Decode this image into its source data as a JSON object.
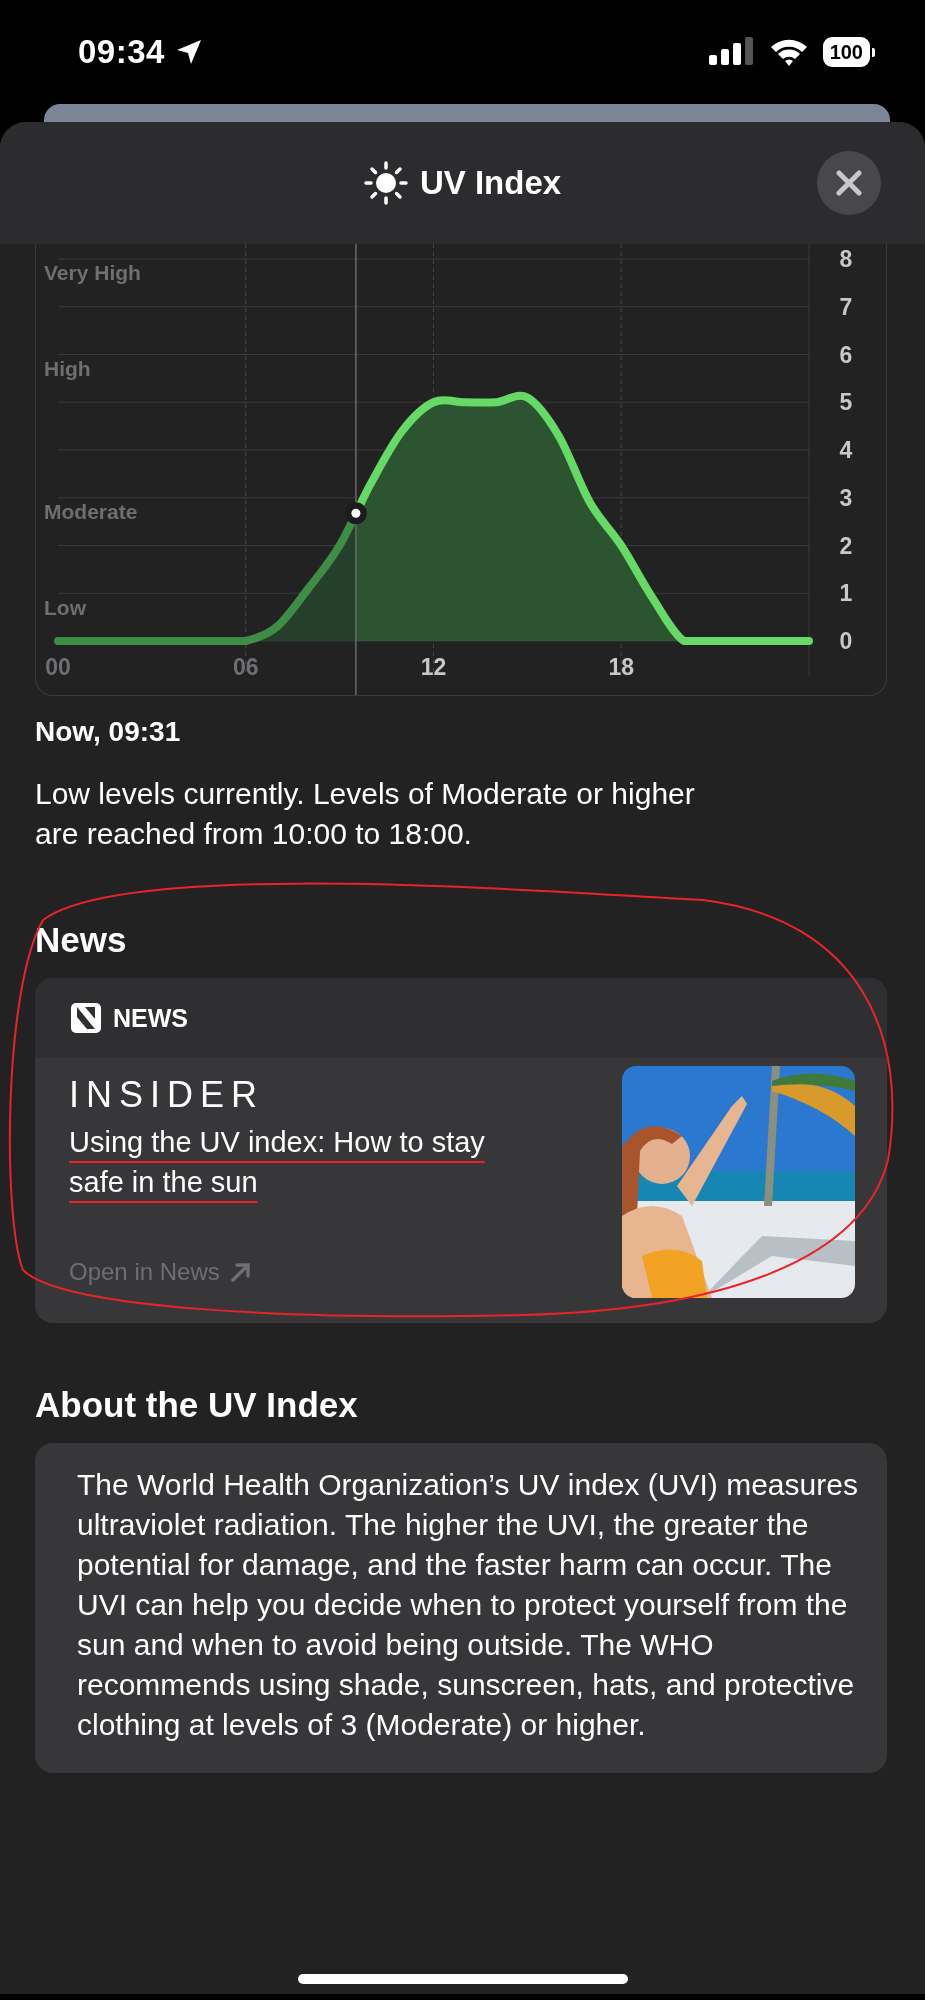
{
  "status_bar": {
    "time": "09:34",
    "battery": "100"
  },
  "sheet": {
    "title": "UV Index"
  },
  "chart": {
    "chart_data": {
      "type": "area",
      "x": [
        0,
        1,
        2,
        3,
        4,
        5,
        6,
        7,
        8,
        9,
        10,
        11,
        12,
        13,
        14,
        15,
        16,
        17,
        18,
        19,
        20,
        21,
        22,
        23,
        24
      ],
      "values": [
        0,
        0,
        0,
        0,
        0,
        0,
        0,
        0.3,
        1.1,
        2.0,
        3.3,
        4.4,
        5.0,
        5.0,
        5.0,
        5.1,
        4.3,
        2.9,
        2.0,
        0.9,
        0,
        0,
        0,
        0,
        0
      ],
      "xlim": [
        0,
        24
      ],
      "ylim": [
        0,
        8
      ],
      "xticks": [
        {
          "value": 0,
          "label": "00"
        },
        {
          "value": 6,
          "label": "06"
        },
        {
          "value": 12,
          "label": "12"
        },
        {
          "value": 18,
          "label": "18"
        }
      ],
      "yticks": [
        0,
        1,
        2,
        3,
        4,
        5,
        6,
        7,
        8
      ],
      "grid": true,
      "ref_lines": [
        {
          "axis": "x",
          "value": 9.52
        }
      ]
    },
    "level_labels": [
      "Very High",
      "High",
      "Moderate",
      "Low"
    ]
  },
  "current": {
    "heading": "Now, 09:31",
    "summary": "Low levels currently. Levels of Moderate or higher are reached from 10:00 to 18:00."
  },
  "news": {
    "heading": "News",
    "source_label": "NEWS",
    "publisher": "INSIDER",
    "headline": "Using the UV index: How to stay safe in the sun",
    "link": "Open in News"
  },
  "about": {
    "heading": "About the UV Index",
    "body": "The World Health Organization’s UV index (UVI) measures ultraviolet radiation. The higher the UVI, the greater the potential for damage, and the faster harm can occur. The UVI can help you decide when to protect yourself from the sun and when to avoid being outside. The WHO recommends using shade, sunscreen, hats, and protective clothing at levels of 3 (Moderate) or higher."
  }
}
